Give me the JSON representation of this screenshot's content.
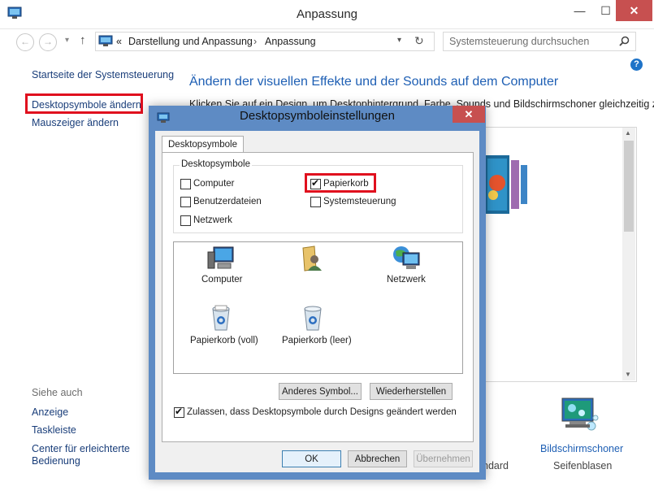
{
  "window": {
    "title": "Anpassung",
    "minimize": "—",
    "maximize": "☐",
    "close": "✕"
  },
  "nav": {
    "breadcrumb_sep": "«",
    "crumbs": [
      "Darstellung und Anpassung",
      "Anpassung"
    ],
    "crumb_arrow": "›",
    "search_placeholder": "Systemsteuerung durchsuchen"
  },
  "sidebar": {
    "home": "Startseite der Systemsteuerung",
    "links": [
      "Desktopsymbole ändern",
      "Mauszeiger ändern"
    ],
    "see_also_title": "Siehe auch",
    "see_also": [
      "Anzeige",
      "Taskleiste",
      "Center für erleichterte",
      "Bedienung"
    ]
  },
  "main": {
    "heading": "Ändern der visuellen Effekte und der Sounds auf dem Computer",
    "intro": "Klicken Sie auf ein Design, um Desktophintergrund, Farbe, Sounds und Bildschirmschoner gleichzeitig zu",
    "bottom_labels": {
      "partial": "ndard",
      "screensaver": "Bildschirmschoner",
      "screensaver_value": "Seifenblasen"
    }
  },
  "dialog": {
    "title": "Desktopsymboleinstellungen",
    "tab": "Desktopsymbole",
    "group_label": "Desktopsymbole",
    "checkboxes": [
      {
        "label": "Computer",
        "checked": false
      },
      {
        "label": "Papierkorb",
        "checked": true
      },
      {
        "label": "Benutzerdateien",
        "checked": false
      },
      {
        "label": "Systemsteuerung",
        "checked": false
      },
      {
        "label": "Netzwerk",
        "checked": false
      }
    ],
    "icons": [
      {
        "label": "Computer",
        "icon": "computer-icon"
      },
      {
        "label": "",
        "icon": "user-files-icon"
      },
      {
        "label": "Netzwerk",
        "icon": "network-icon"
      },
      {
        "label": "Papierkorb (voll)",
        "icon": "recycle-bin-full-icon"
      },
      {
        "label": "Papierkorb (leer)",
        "icon": "recycle-bin-empty-icon"
      }
    ],
    "buttons": {
      "change_icon": "Anderes Symbol...",
      "restore": "Wiederherstellen",
      "ok": "OK",
      "cancel": "Abbrechen",
      "apply": "Übernehmen"
    },
    "allow_themes": {
      "label": "Zulassen, dass Desktopsymbole durch Designs geändert werden",
      "checked": true
    }
  },
  "colors": {
    "accent_link": "#1a3e7a",
    "heading": "#1e5fb4",
    "highlight": "#e0101e",
    "dialog_frame": "#5e8bc4",
    "close_button": "#c75050"
  }
}
